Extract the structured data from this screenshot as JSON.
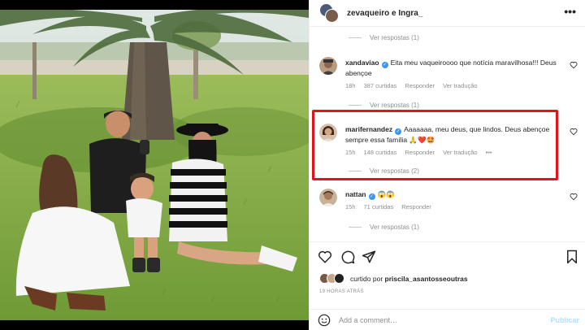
{
  "header": {
    "username": "zevaqueiro e Ingra_"
  },
  "comments": {
    "top_view_replies": "Ver respostas (1)",
    "items": [
      {
        "username": "xandaviao",
        "verified": true,
        "text": "Eita meu vaqueiroooo que notícia maravilhosa!!! Deus abençoe",
        "time": "18h",
        "likes": "387 curtidas",
        "reply": "Responder",
        "translate": "Ver tradução",
        "view_replies": "Ver respostas (1)"
      },
      {
        "username": "marifernandez",
        "verified": true,
        "text": "Aaaaaaa, meu deus, que lindos. Deus abençoe sempre essa família 🙏❤️🤩",
        "time": "15h",
        "likes": "148 curtidas",
        "reply": "Responder",
        "translate": "Ver tradução",
        "more": "•••",
        "view_replies": "Ver respostas (2)"
      },
      {
        "username": "nattan",
        "verified": true,
        "text": "😱😱",
        "time": "15h",
        "likes": "71 curtidas",
        "reply": "Responder",
        "view_replies": "Ver respostas (1)"
      }
    ]
  },
  "actions": {
    "liked_prefix": "curtido por",
    "liked_user": "priscila_asantos",
    "liked_suffix": "seoutras",
    "timestamp": "19 HORAS ATRÁS"
  },
  "add_comment": {
    "placeholder": "Add a comment…",
    "publish_label": "Publicar"
  },
  "colors": {
    "accent": "#3897f0",
    "highlight": "#e3131a",
    "publish_disabled": "#b2dffc"
  }
}
